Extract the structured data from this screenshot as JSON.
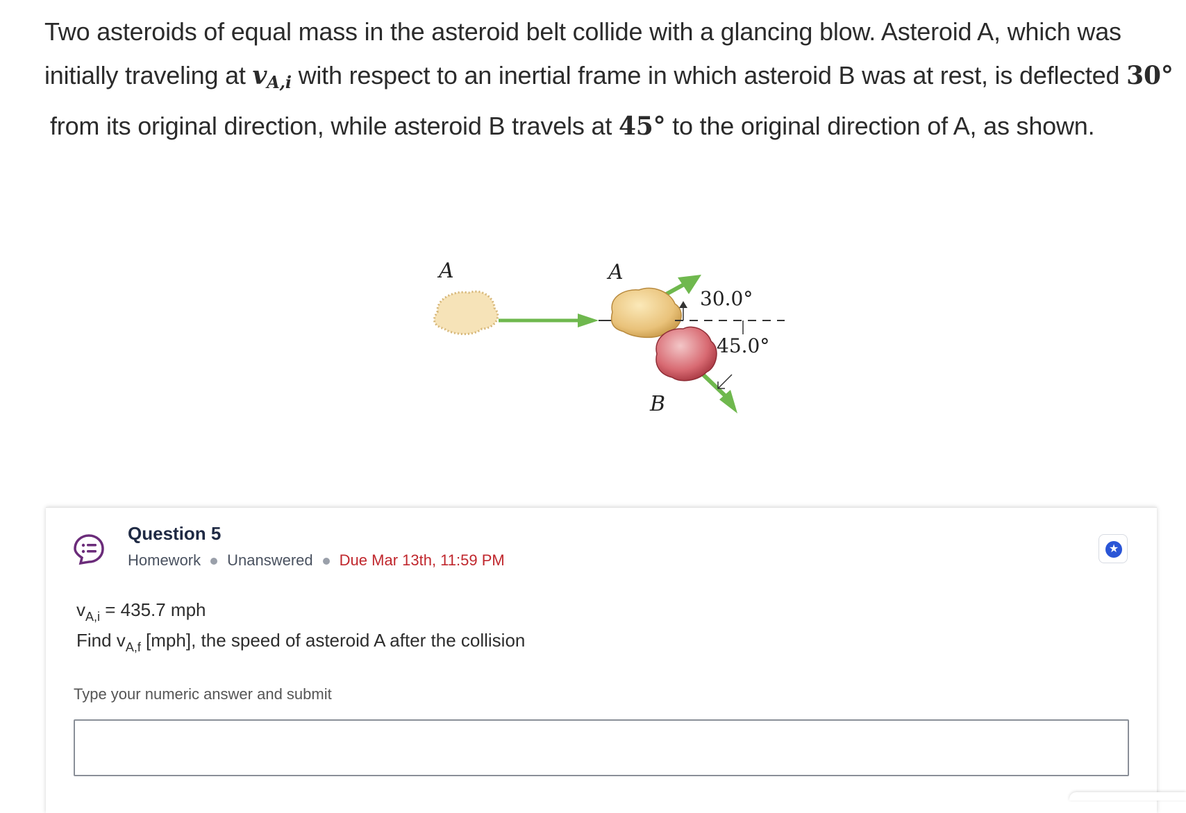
{
  "problem": {
    "line1": "Two asteroids of equal mass in the asteroid belt collide with a glancing blow. Asteroid A, which was",
    "line2_pre": "initially traveling at ",
    "line2_var": "v",
    "line2_var_sub": "A,i",
    "line2_mid": " with respect to an inertial frame in which asteroid B was at rest, is deflected ",
    "line2_angle": "30°",
    "line3_pre": "from its original direction, while asteroid B travels at ",
    "line3_angle": "45°",
    "line3_post": " to the original direction of A, as shown."
  },
  "figure": {
    "label_a_before": "A",
    "label_a_after": "A",
    "label_b": "B",
    "angle_a": "30.0°",
    "angle_b": "45.0°",
    "colors": {
      "arrow": "#6fb84e",
      "asteroid_a": "#e9c27a",
      "asteroid_b": "#d86a72"
    }
  },
  "question": {
    "title": "Question 5",
    "type": "Homework",
    "status": "Unanswered",
    "due": "Due Mar 13th, 11:59 PM",
    "icon": "list-bubble-icon",
    "favorite_icon": "star-icon"
  },
  "body": {
    "given_var": "v",
    "given_sub": "A,i",
    "given_value": " = 435.7 mph",
    "find_pre": "Find v",
    "find_sub": "A,f",
    "find_post": " [mph], the speed of asteroid A after the collision",
    "hint": "Type your numeric answer and submit",
    "answer_value": ""
  }
}
